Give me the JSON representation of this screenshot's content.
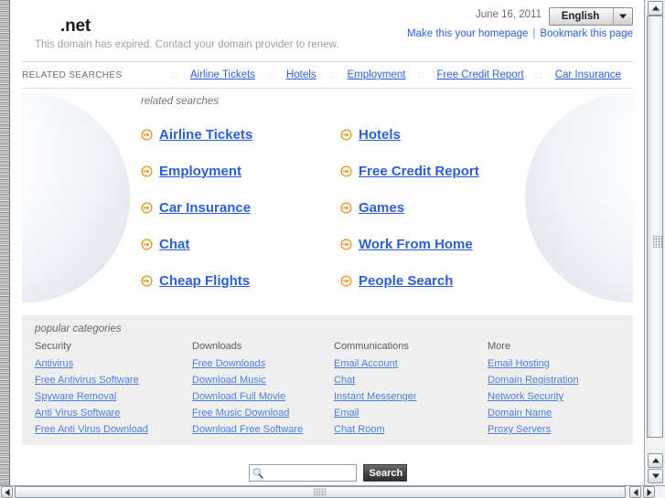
{
  "header": {
    "domain_title": ".net",
    "expired_notice": "This domain has expired. Contact your domain provider to renew.",
    "date": "June 16, 2011",
    "language": "English",
    "make_homepage_label": "Make this your homepage",
    "link_separator": "|",
    "bookmark_label": "Bookmark this page"
  },
  "related_strip": {
    "label": "RELATED SEARCHES",
    "separator": "::",
    "links": [
      "Airline Tickets",
      "Hotels",
      "Employment",
      "Free Credit Report",
      "Car Insurance"
    ]
  },
  "hero": {
    "caption": "related searches",
    "items": [
      "Airline Tickets",
      "Hotels",
      "Employment",
      "Free Credit Report",
      "Car Insurance",
      "Games",
      "Chat",
      "Work From Home",
      "Cheap Flights",
      "People Search"
    ]
  },
  "categories": {
    "caption": "popular categories",
    "columns": [
      {
        "heading": "Security",
        "links": [
          "Antivirus",
          "Free Antivirus Software",
          "Spyware Removal",
          "Anti Virus Software",
          "Free Anti Virus Download"
        ]
      },
      {
        "heading": "Downloads",
        "links": [
          "Free Downloads",
          "Download Music",
          "Download Full Movie",
          "Free Music Download",
          "Download Free Software"
        ]
      },
      {
        "heading": "Communications",
        "links": [
          "Email Account",
          "Chat",
          "Instant Messenger",
          "Email",
          "Chat Room"
        ]
      },
      {
        "heading": "More",
        "links": [
          "Email Hosting",
          "Domain Registration",
          "Network Security",
          "Domain Name",
          "Proxy Servers"
        ]
      }
    ]
  },
  "search": {
    "value": "",
    "placeholder": "",
    "button_label": "Search"
  },
  "colors": {
    "link_blue": "#2b5ed8",
    "category_link_blue": "#4a7fe0",
    "arrow_orange": "#e8931c",
    "panel_gray": "#efefef",
    "muted_text": "#9d9d9d"
  }
}
